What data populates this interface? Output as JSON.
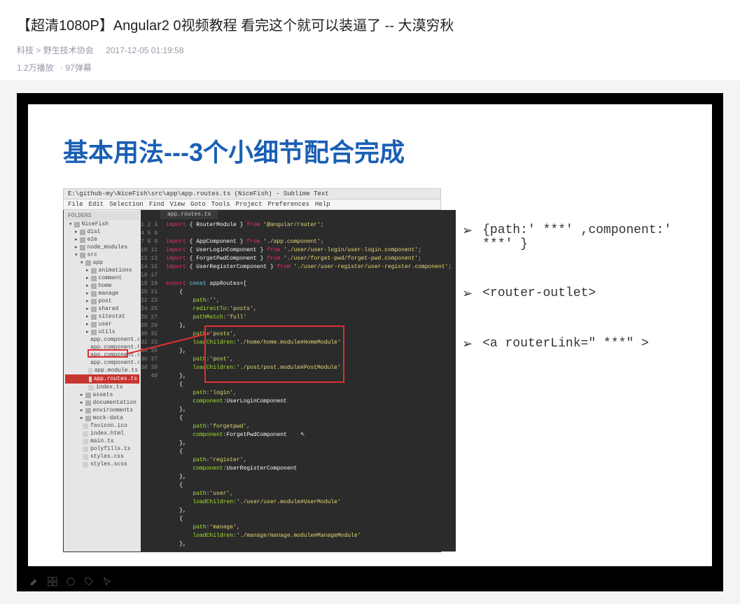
{
  "header": {
    "title": "【超清1080P】Angular2 0视频教程 看完这个就可以装逼了 -- 大漠穷秋",
    "category": "科技",
    "subcategory": "野生技术协会",
    "timestamp": "2017-12-05 01:19:58",
    "plays": "1.2万播放",
    "danmu": "97弹幕"
  },
  "slide": {
    "heading": "基本用法---3个小细节配合完成",
    "bullets": [
      "{path:'  ***'   ,component:'  ***'  }",
      "<router-outlet>",
      "<a routerLink=\"  ***\"  >"
    ]
  },
  "editor": {
    "titlebar": "E:\\github-my\\NiceFish\\src\\app\\app.routes.ts (NiceFish) - Sublime Text",
    "menus": [
      "File",
      "Edit",
      "Selection",
      "Find",
      "View",
      "Goto",
      "Tools",
      "Project",
      "Preferences",
      "Help"
    ],
    "folders_label": "FOLDERS",
    "tab": "app.routes.ts",
    "tree": [
      {
        "t": "NiceFish",
        "i": 0,
        "d": true,
        "o": true
      },
      {
        "t": "dist",
        "i": 1,
        "d": true
      },
      {
        "t": "e2e",
        "i": 1,
        "d": true
      },
      {
        "t": "node_modules",
        "i": 1,
        "d": true
      },
      {
        "t": "src",
        "i": 1,
        "d": true,
        "o": true
      },
      {
        "t": "app",
        "i": 2,
        "d": true,
        "o": true
      },
      {
        "t": "animations",
        "i": 3,
        "d": true
      },
      {
        "t": "comment",
        "i": 3,
        "d": true
      },
      {
        "t": "home",
        "i": 3,
        "d": true
      },
      {
        "t": "manage",
        "i": 3,
        "d": true
      },
      {
        "t": "post",
        "i": 3,
        "d": true
      },
      {
        "t": "shared",
        "i": 3,
        "d": true
      },
      {
        "t": "sitestat",
        "i": 3,
        "d": true
      },
      {
        "t": "user",
        "i": 3,
        "d": true
      },
      {
        "t": "utils",
        "i": 3,
        "d": true
      },
      {
        "t": "app.component.css",
        "i": 3
      },
      {
        "t": "app.component.html",
        "i": 3
      },
      {
        "t": "app.component.scss",
        "i": 3
      },
      {
        "t": "app.component.spec.ts",
        "i": 3
      },
      {
        "t": "app.module.ts",
        "i": 3
      },
      {
        "t": "app.routes.ts",
        "i": 3,
        "hl": true
      },
      {
        "t": "index.ts",
        "i": 3
      },
      {
        "t": "assets",
        "i": 2,
        "d": true
      },
      {
        "t": "documentation",
        "i": 2,
        "d": true
      },
      {
        "t": "environments",
        "i": 2,
        "d": true
      },
      {
        "t": "mock-data",
        "i": 2,
        "d": true
      },
      {
        "t": "favicon.ico",
        "i": 2
      },
      {
        "t": "index.html",
        "i": 2
      },
      {
        "t": "main.ts",
        "i": 2
      },
      {
        "t": "polyfills.ts",
        "i": 2
      },
      {
        "t": "styles.css",
        "i": 2
      },
      {
        "t": "styles.scss",
        "i": 2
      }
    ],
    "line_count": 40
  }
}
